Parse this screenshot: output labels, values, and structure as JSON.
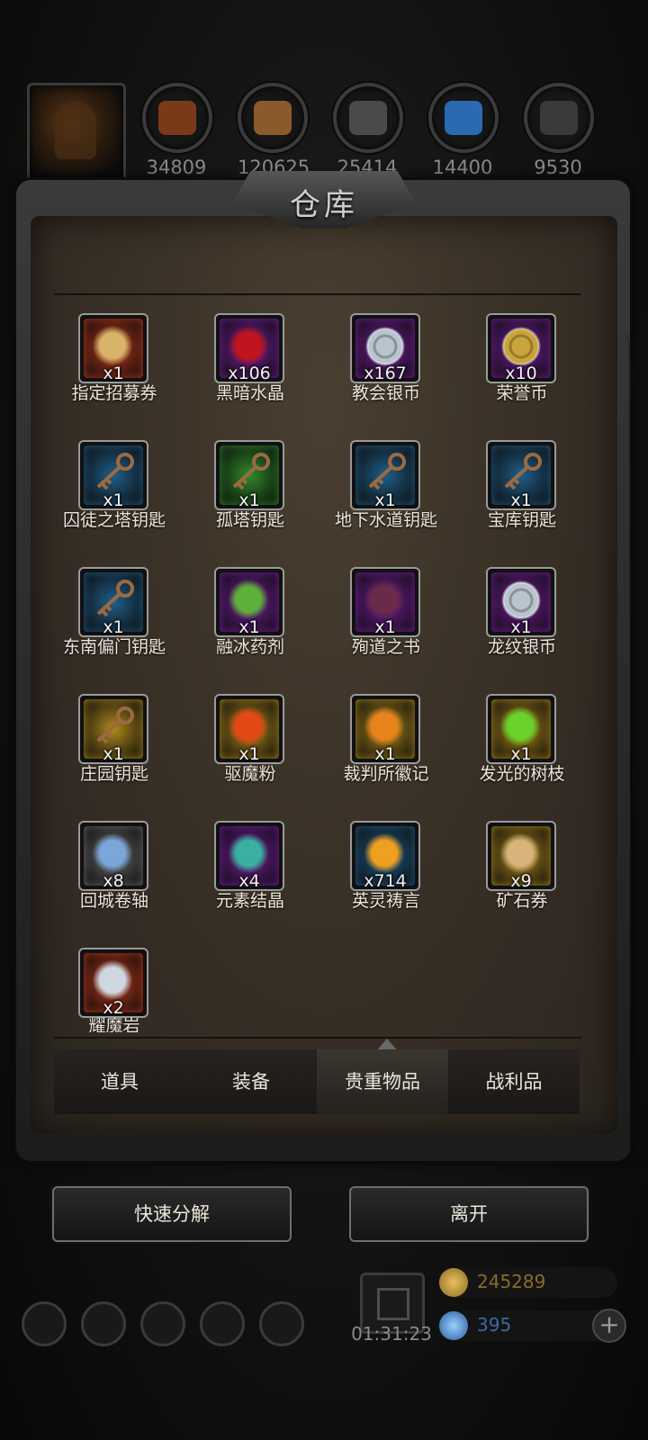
{
  "resources": [
    {
      "icon": "ore-pile-icon",
      "value": "34809",
      "color": "#7a3a1a"
    },
    {
      "icon": "wood-plank-icon",
      "value": "120625",
      "color": "#8a5a2a"
    },
    {
      "icon": "iron-ingot-icon",
      "value": "25414",
      "color": "#4a4a4a"
    },
    {
      "icon": "blue-crystal-icon",
      "value": "14400",
      "color": "#2a6ab0"
    },
    {
      "icon": "stone-block-icon",
      "value": "9530",
      "color": "#3a3a3a"
    }
  ],
  "warehouse": {
    "title": "仓库",
    "items": [
      {
        "name": "指定招募券",
        "qty": "x1",
        "rarity": "#c0391c",
        "art": "scroll-icon",
        "artColor": "#d7b46a"
      },
      {
        "name": "黑暗水晶",
        "qty": "x106",
        "rarity": "#7a1fa0",
        "art": "dark-crystal-icon",
        "artColor": "#c0141e"
      },
      {
        "name": "教会银币",
        "qty": "x167",
        "rarity": "#7a1fa0",
        "art": "silver-coin-icon",
        "artColor": "#b9c4cc"
      },
      {
        "name": "荣誉币",
        "qty": "x10",
        "rarity": "#7a1fa0",
        "art": "gold-coin-icon",
        "artColor": "#c9a43c"
      },
      {
        "name": "囚徒之塔钥匙",
        "qty": "x1",
        "rarity": "#1f5f8a",
        "art": "key-icon",
        "artColor": "#9c6a42"
      },
      {
        "name": "孤塔钥匙",
        "qty": "x1",
        "rarity": "#2f8a2a",
        "art": "key-icon",
        "artColor": "#9c6a42"
      },
      {
        "name": "地下水道钥匙",
        "qty": "x1",
        "rarity": "#1f5f8a",
        "art": "key-icon",
        "artColor": "#9c6a42"
      },
      {
        "name": "宝库钥匙",
        "qty": "x1",
        "rarity": "#1f5f8a",
        "art": "key-icon",
        "artColor": "#9c6a42"
      },
      {
        "name": "东南偏门钥匙",
        "qty": "x1",
        "rarity": "#1f5f8a",
        "art": "key-icon",
        "artColor": "#9c6a42"
      },
      {
        "name": "融冰药剂",
        "qty": "x1",
        "rarity": "#7a1fa0",
        "art": "cauldron-icon",
        "artColor": "#5fb03a"
      },
      {
        "name": "殉道之书",
        "qty": "x1",
        "rarity": "#7a1fa0",
        "art": "book-icon",
        "artColor": "#6a2a4a"
      },
      {
        "name": "龙纹银币",
        "qty": "x1",
        "rarity": "#7a1fa0",
        "art": "silver-coin-icon",
        "artColor": "#b9c4cc"
      },
      {
        "name": "庄园钥匙",
        "qty": "x1",
        "rarity": "#b08a1a",
        "art": "key-icon",
        "artColor": "#9c6a42"
      },
      {
        "name": "驱魔粉",
        "qty": "x1",
        "rarity": "#b08a1a",
        "art": "powder-icon",
        "artColor": "#e24a14"
      },
      {
        "name": "裁判所徽记",
        "qty": "x1",
        "rarity": "#b08a1a",
        "art": "emblem-icon",
        "artColor": "#e8841c"
      },
      {
        "name": "发光的树枝",
        "qty": "x1",
        "rarity": "#b08a1a",
        "art": "glowing-branch-icon",
        "artColor": "#6ad22a"
      },
      {
        "name": "回城卷轴",
        "qty": "x8",
        "rarity": "#6a6a6a",
        "art": "portal-scroll-icon",
        "artColor": "#7aa6d8"
      },
      {
        "name": "元素结晶",
        "qty": "x4",
        "rarity": "#7a1fa0",
        "art": "element-crystal-icon",
        "artColor": "#3ab0a0"
      },
      {
        "name": "英灵祷言",
        "qty": "x714",
        "rarity": "#1f5f8a",
        "art": "fire-orb-icon",
        "artColor": "#f0a020"
      },
      {
        "name": "矿石券",
        "qty": "x9",
        "rarity": "#b08a1a",
        "art": "voucher-icon",
        "artColor": "#d8b47a"
      },
      {
        "name": "耀魔岩",
        "qty": "x2",
        "rarity": "#c0391c",
        "art": "crystal-rock-icon",
        "artColor": "#cfd8e0"
      }
    ]
  },
  "tabs": [
    {
      "label": "道具",
      "active": false
    },
    {
      "label": "装备",
      "active": false
    },
    {
      "label": "贵重物品",
      "active": true
    },
    {
      "label": "战利品",
      "active": false
    }
  ],
  "buttons": {
    "salvage": "快速分解",
    "leave": "离开"
  },
  "hud": {
    "timer": "01:31:23",
    "gold": "245289",
    "gems": "395",
    "goldColor": "#8a6a2a",
    "gemColor": "#3a6aa0"
  }
}
